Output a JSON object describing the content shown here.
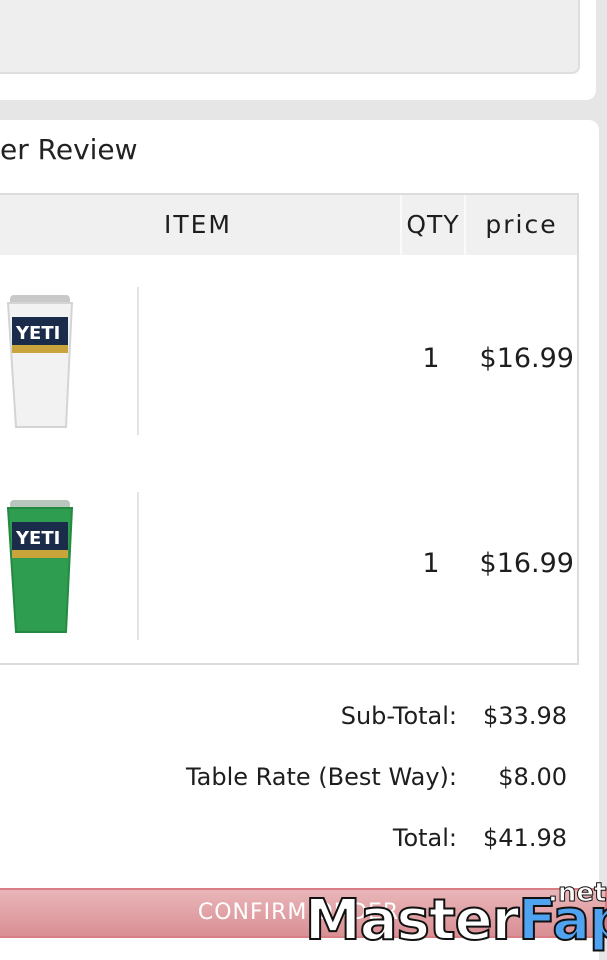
{
  "order": {
    "title": "er Review",
    "columns": {
      "item": "ITEM",
      "qty": "QTY",
      "price": "price"
    },
    "items": [
      {
        "name": "yeti-tumbler-white",
        "image_label": "YETI",
        "qty": "1",
        "price": "$16.99",
        "color": "#f2f2f2"
      },
      {
        "name": "yeti-tumbler-green",
        "image_label": "YETI",
        "qty": "1",
        "price": "$16.99",
        "color": "#2f9d4f"
      }
    ]
  },
  "totals": {
    "subtotal_label": "Sub-Total:",
    "subtotal_value": "$33.98",
    "shipping_label": "Table Rate (Best Way):",
    "shipping_value": "$8.00",
    "total_label": "Total:",
    "total_value": "$41.98"
  },
  "confirm": {
    "label": "CONFIRM ORDER"
  },
  "watermark": {
    "part1": "Master",
    "part2": "Fap",
    "suffix": ".net"
  },
  "colors": {
    "confirm_bg": "#e0a4a8",
    "header_bg": "#f0f0f0",
    "tumbler_white": "#f2f2f2",
    "tumbler_green": "#2f9d4f"
  }
}
